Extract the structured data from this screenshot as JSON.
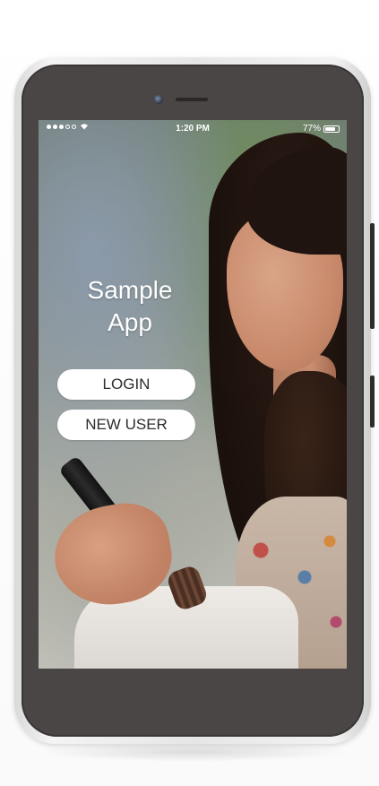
{
  "status_bar": {
    "signal_dots_filled": 3,
    "signal_dots_total": 5,
    "time": "1:20 PM",
    "battery_percent_text": "77%",
    "battery_level": 0.77
  },
  "app": {
    "title_line1": "Sample",
    "title_line2": "App",
    "login_label": "LOGIN",
    "new_user_label": "NEW USER"
  },
  "colors": {
    "phone_bezel": "#4a4645",
    "phone_rim": "#e6e6e6",
    "button_bg": "#ffffff",
    "button_text": "#2c2c2c",
    "title_text": "#ffffff"
  },
  "icons": {
    "wifi": "wifi-icon",
    "battery": "battery-icon",
    "camera": "front-camera-icon"
  }
}
